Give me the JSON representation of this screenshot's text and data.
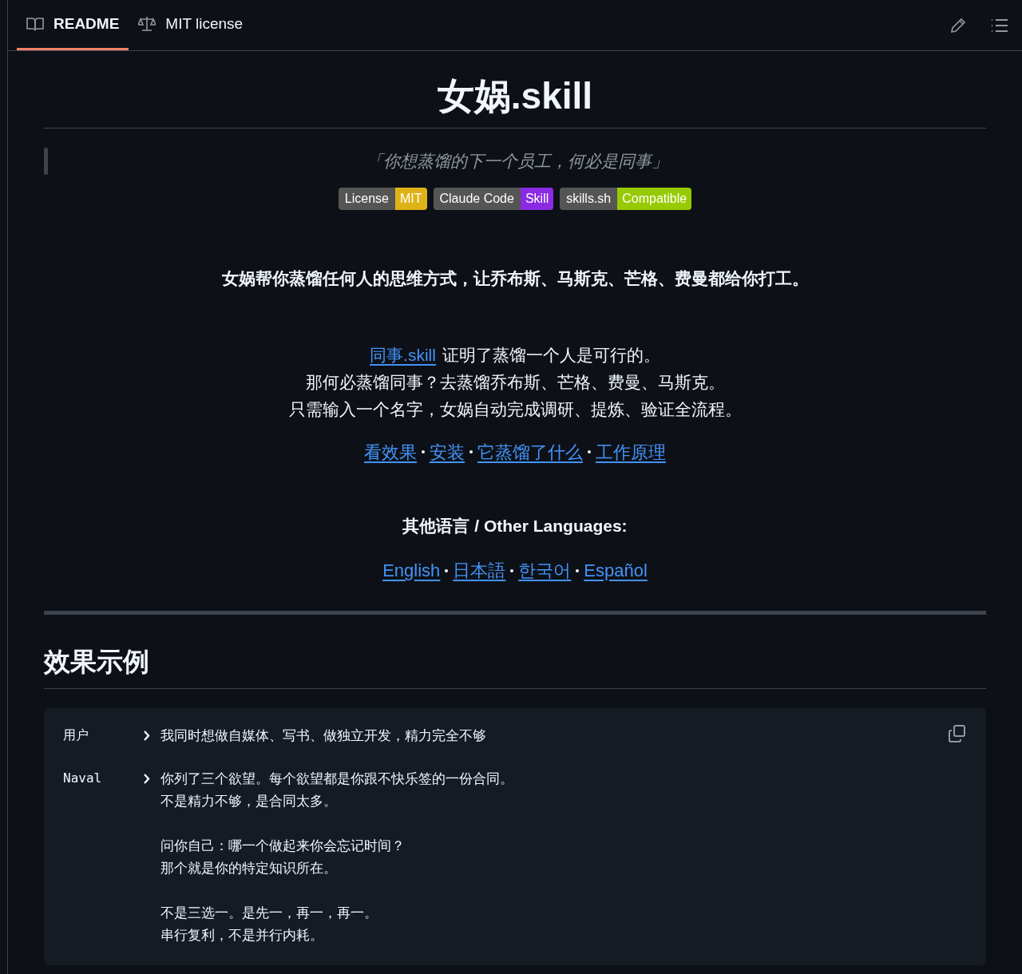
{
  "tabs": [
    {
      "label": "README",
      "selected": true
    },
    {
      "label": "MIT license",
      "selected": false
    }
  ],
  "title": "女娲.skill",
  "quote": "「你想蒸馏的下一个员工，何必是同事」",
  "badges": [
    {
      "label": "License",
      "value": "MIT",
      "color": "#dfb317"
    },
    {
      "label": "Claude Code",
      "value": "Skill",
      "color": "#8a2be2"
    },
    {
      "label": "skills.sh",
      "value": "Compatible",
      "color": "#97ca00"
    }
  ],
  "tagline": "女娲帮你蒸馏任何人的思维方式，让乔布斯、马斯克、芒格、费曼都给你打工。",
  "intro": [
    {
      "link": "同事.skill",
      "text": "证明了蒸馏一个人是可行的。"
    },
    {
      "text": "那何必蒸馏同事？去蒸馏乔布斯、芒格、费曼、马斯克。"
    },
    {
      "text": "只需输入一个名字，女娲自动完成调研、提炼、验证全流程。"
    }
  ],
  "nav_links": [
    "看效果",
    "安装",
    "它蒸馏了什么",
    "工作原理"
  ],
  "languages_heading": "其他语言 / Other Languages:",
  "language_links": [
    "English",
    "日本語",
    "한국어",
    "Español"
  ],
  "section_heading": "效果示例",
  "example": [
    {
      "speaker": "用户",
      "paragraphs": [
        [
          "我同时想做自媒体、写书、做独立开发，精力完全不够"
        ]
      ]
    },
    {
      "speaker": "Naval",
      "paragraphs": [
        [
          "你列了三个欲望。每个欲望都是你跟不快乐签的一份合同。",
          "不是精力不够，是合同太多。"
        ],
        [
          "问你自己：哪一个做起来你会忘记时间？",
          "那个就是你的特定知识所在。"
        ],
        [
          "不是三选一。是先一，再一，再一。",
          "串行复利，不是并行内耗。"
        ]
      ]
    }
  ]
}
